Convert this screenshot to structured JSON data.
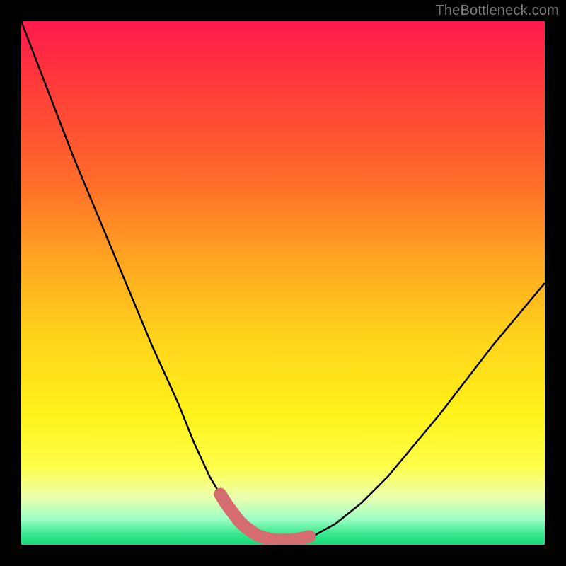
{
  "watermark": "TheBottleneck.com",
  "colors": {
    "background": "#000000",
    "curve": "#000000",
    "highlight": "#d56d70",
    "watermark": "#7a7a7a"
  },
  "chart_data": {
    "type": "line",
    "title": "",
    "xlabel": "",
    "ylabel": "",
    "xlim": [
      0,
      100
    ],
    "ylim": [
      0,
      100
    ],
    "grid": false,
    "series": [
      {
        "name": "bottleneck-curve",
        "x": [
          0,
          5,
          10,
          15,
          20,
          25,
          30,
          33,
          36,
          39,
          42,
          45,
          48,
          52,
          56,
          60,
          65,
          70,
          75,
          80,
          85,
          90,
          95,
          100
        ],
        "y": [
          100,
          87,
          74,
          62,
          50,
          38,
          27,
          19.5,
          13,
          8,
          4,
          1.8,
          0.9,
          0.9,
          1.8,
          4,
          8,
          13,
          19,
          25,
          31.5,
          38,
          44,
          50
        ]
      }
    ],
    "highlight_region": {
      "description": "thick flat segment at curve minimum",
      "x_start": 38,
      "x_end": 55,
      "approx_y": 1.5
    },
    "gradient_stops_percent_from_top": {
      "red": 0,
      "orange": 40,
      "yellow": 75,
      "pale": 90,
      "green": 100
    }
  }
}
